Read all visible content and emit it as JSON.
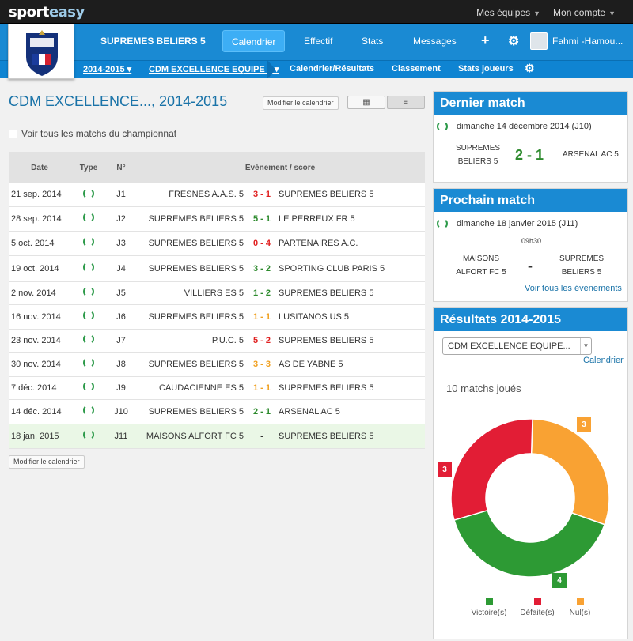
{
  "app": {
    "logo_a": "sport",
    "logo_b": "easy"
  },
  "topnav": {
    "teams": "Mes équipes",
    "account": "Mon compte"
  },
  "header": {
    "team": "SUPREMES BELIERS 5",
    "nav": [
      "Calendrier",
      "Effectif",
      "Stats",
      "Messages"
    ],
    "user": "Fahmi -Hamou..."
  },
  "subnav": {
    "season": "2014-2015 ▾",
    "competition": "CDM EXCELLENCE EQUIPE 5 ▾",
    "calendar": "Calendrier/Résultats",
    "ranking": "Classement",
    "player_stats": "Stats joueurs"
  },
  "page": {
    "title": "CDM EXCELLENCE..., 2014-2015",
    "edit_calendar": "Modifier le calendrier",
    "show_all": "Voir tous les matchs du championnat",
    "edit_calendar_bottom": "Modifier le calendrier"
  },
  "table": {
    "headers": {
      "date": "Date",
      "type": "Type",
      "num": "N°",
      "event": "Evènement / score"
    },
    "rows": [
      {
        "date": "21 sep. 2014",
        "num": "J1",
        "home": "FRESNES A.A.S. 5",
        "score": "3 - 1",
        "color": "#e02020",
        "away": "SUPREMES BELIERS 5"
      },
      {
        "date": "28 sep. 2014",
        "num": "J2",
        "home": "SUPREMES BELIERS 5",
        "score": "5 - 1",
        "color": "#2d8a2d",
        "away": "LE PERREUX FR 5"
      },
      {
        "date": "5 oct. 2014",
        "num": "J3",
        "home": "SUPREMES BELIERS 5",
        "score": "0 - 4",
        "color": "#e02020",
        "away": "PARTENAIRES A.C."
      },
      {
        "date": "19 oct. 2014",
        "num": "J4",
        "home": "SUPREMES BELIERS 5",
        "score": "3 - 2",
        "color": "#2d8a2d",
        "away": "SPORTING CLUB PARIS 5"
      },
      {
        "date": "2 nov. 2014",
        "num": "J5",
        "home": "VILLIERS ES 5",
        "score": "1 - 2",
        "color": "#2d8a2d",
        "away": "SUPREMES BELIERS 5"
      },
      {
        "date": "16 nov. 2014",
        "num": "J6",
        "home": "SUPREMES BELIERS 5",
        "score": "1 - 1",
        "color": "#f0a020",
        "away": "LUSITANOS US 5"
      },
      {
        "date": "23 nov. 2014",
        "num": "J7",
        "home": "P.U.C. 5",
        "score": "5 - 2",
        "color": "#e02020",
        "away": "SUPREMES BELIERS 5"
      },
      {
        "date": "30 nov. 2014",
        "num": "J8",
        "home": "SUPREMES BELIERS 5",
        "score": "3 - 3",
        "color": "#f0a020",
        "away": "AS DE YABNE 5"
      },
      {
        "date": "7 déc. 2014",
        "num": "J9",
        "home": "CAUDACIENNE ES 5",
        "score": "1 - 1",
        "color": "#f0a020",
        "away": "SUPREMES BELIERS 5"
      },
      {
        "date": "14 déc. 2014",
        "num": "J10",
        "home": "SUPREMES BELIERS 5",
        "score": "2 - 1",
        "color": "#2d8a2d",
        "away": "ARSENAL AC 5"
      },
      {
        "date": "18 jan. 2015",
        "num": "J11",
        "home": "MAISONS ALFORT FC 5",
        "score": "-",
        "color": "#333333",
        "away": "SUPREMES BELIERS 5",
        "upcoming": true
      }
    ]
  },
  "last_match": {
    "title": "Dernier match",
    "date": "dimanche 14 décembre 2014 (J10)",
    "home_l1": "SUPREMES",
    "home_l2": "BELIERS 5",
    "score": "2 - 1",
    "away": "ARSENAL AC 5"
  },
  "next_match": {
    "title": "Prochain match",
    "date": "dimanche 18 janvier 2015 (J11)",
    "time": "09h30",
    "home_l1": "MAISONS",
    "home_l2": "ALFORT FC 5",
    "score": "-",
    "away_l1": "SUPREMES",
    "away_l2": "BELIERS 5",
    "link": "Voir tous les événements"
  },
  "results": {
    "title": "Résultats 2014-2015",
    "select": "CDM EXCELLENCE EQUIPE...",
    "calendar_link": "Calendrier",
    "played": "10 matchs joués"
  },
  "chart_data": {
    "type": "pie",
    "categories": [
      "Victoire(s)",
      "Défaite(s)",
      "Nul(s)"
    ],
    "values": [
      4,
      3,
      3
    ],
    "colors": [
      "#2d9a34",
      "#e21d35",
      "#f9a233"
    ]
  }
}
